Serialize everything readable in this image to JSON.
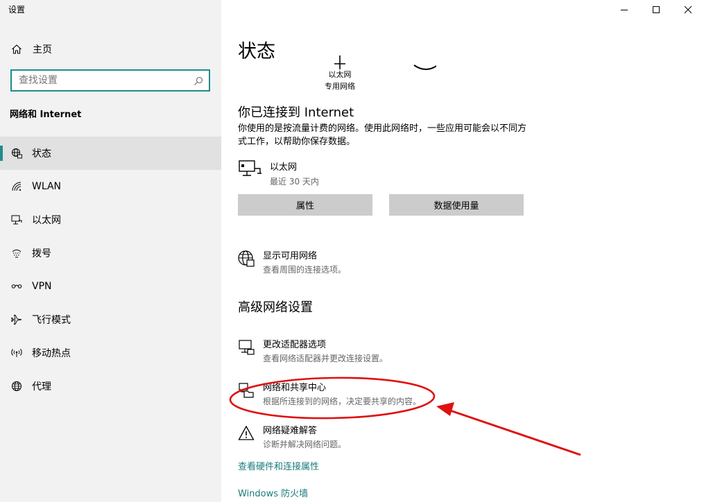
{
  "window": {
    "title": "设置",
    "controls": [
      "minimize-icon",
      "maximize-icon",
      "close-icon"
    ]
  },
  "sidebar": {
    "home_label": "主页",
    "search_placeholder": "查找设置",
    "section_title": "网络和 Internet",
    "items": [
      {
        "label": "状态",
        "icon": "globe-status-icon",
        "active": true
      },
      {
        "label": "WLAN",
        "icon": "wifi-icon",
        "active": false
      },
      {
        "label": "以太网",
        "icon": "ethernet-icon",
        "active": false
      },
      {
        "label": "拨号",
        "icon": "dialup-icon",
        "active": false
      },
      {
        "label": "VPN",
        "icon": "vpn-icon",
        "active": false
      },
      {
        "label": "飞行模式",
        "icon": "airplane-icon",
        "active": false
      },
      {
        "label": "移动热点",
        "icon": "hotspot-icon",
        "active": false
      },
      {
        "label": "代理",
        "icon": "globe-icon",
        "active": false
      }
    ]
  },
  "main": {
    "title": "状态",
    "diagram": {
      "adapter_type": "以太网",
      "network_type": "专用网络"
    },
    "connection_title": "你已连接到 Internet",
    "connection_desc": "你使用的是按流量计费的网络。使用此网络时，一些应用可能会以不同方式工作，以帮助你保存数据。",
    "adapter": {
      "name": "以太网",
      "usage": "最近 30 天内"
    },
    "buttons": {
      "properties": "属性",
      "data_usage": "数据使用量"
    },
    "show_networks": {
      "title": "显示可用网络",
      "desc": "查看周围的连接选项。"
    },
    "advanced_title": "高级网络设置",
    "advanced": {
      "adapter_options": {
        "title": "更改适配器选项",
        "desc": "查看网络适配器并更改连接设置。"
      },
      "sharing_center": {
        "title": "网络和共享中心",
        "desc": "根据所连接到的网络，决定要共享的内容。"
      },
      "troubleshoot": {
        "title": "网络疑难解答",
        "desc": "诊断并解决网络问题。"
      }
    },
    "links": {
      "hardware": "查看硬件和连接属性",
      "firewall": "Windows 防火墙"
    }
  },
  "colors": {
    "accent": "#1f8c8c",
    "link": "#1b7c7c",
    "annotation": "#e01010"
  }
}
